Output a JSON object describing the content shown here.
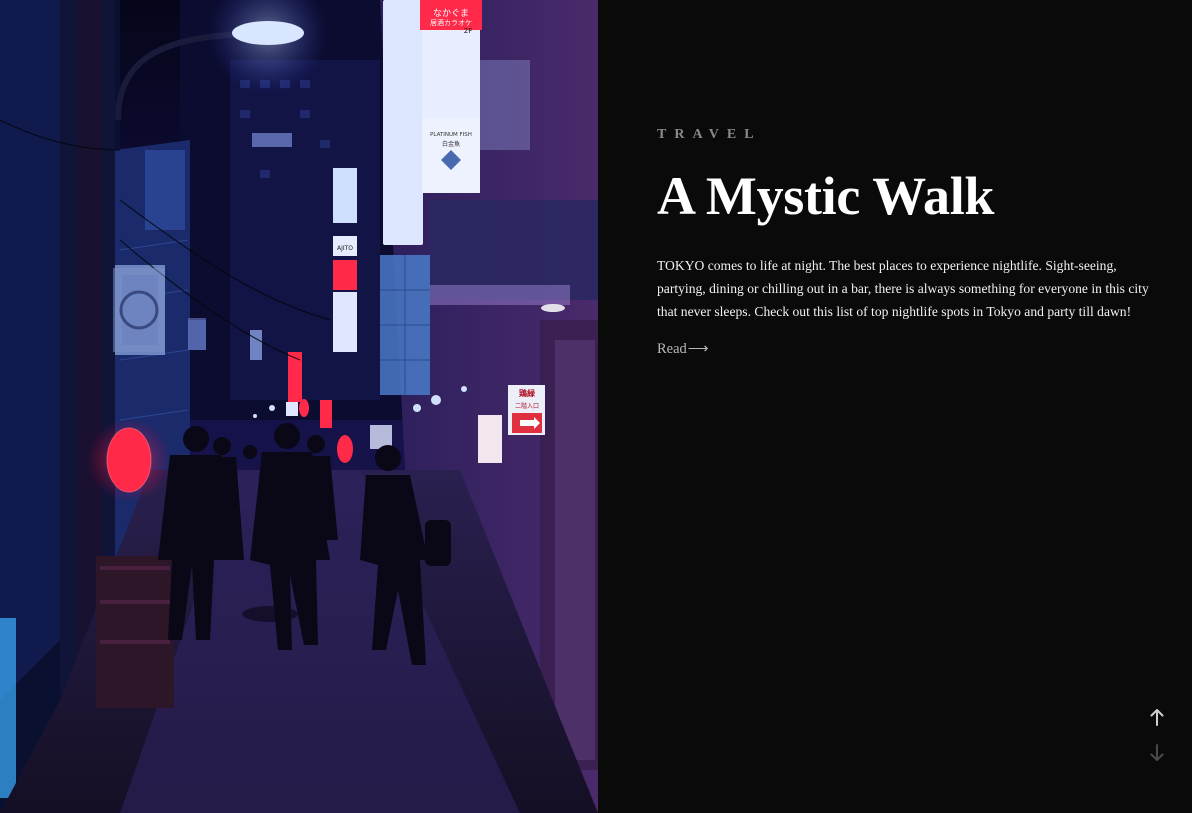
{
  "hero": {
    "sign_karaoke": "なかぐま",
    "sign_karaoke_sub": "居酒カラオケ",
    "sign_floor": "2F",
    "sign_platinum": "PLATINUM FISH",
    "sign_platinum_sub": "白金魚",
    "sign_ajito": "AJITO",
    "sign_torigen": "鶏緑",
    "sign_entrance": "二階入口"
  },
  "article": {
    "category": "TRAVEL",
    "title": "A Mystic Walk",
    "excerpt": "TOKYO comes to life at night. The best places to experience nightlife. Sight-seeing, partying, dining or chilling out in a bar, there is always something for everyone in this city that never sleeps. Check out this list of top nightlife spots in Tokyo and party till dawn!",
    "read_label": "Read",
    "read_arrow": "⟶"
  },
  "nav": {
    "up_icon": "arrow-up-icon",
    "down_icon": "arrow-down-icon"
  },
  "colors": {
    "background": "#0a0a0a",
    "title": "#ffffff",
    "category": "#8a8a8a",
    "lantern": "#ff2a4a",
    "neon_blue": "#5fa8ff"
  }
}
